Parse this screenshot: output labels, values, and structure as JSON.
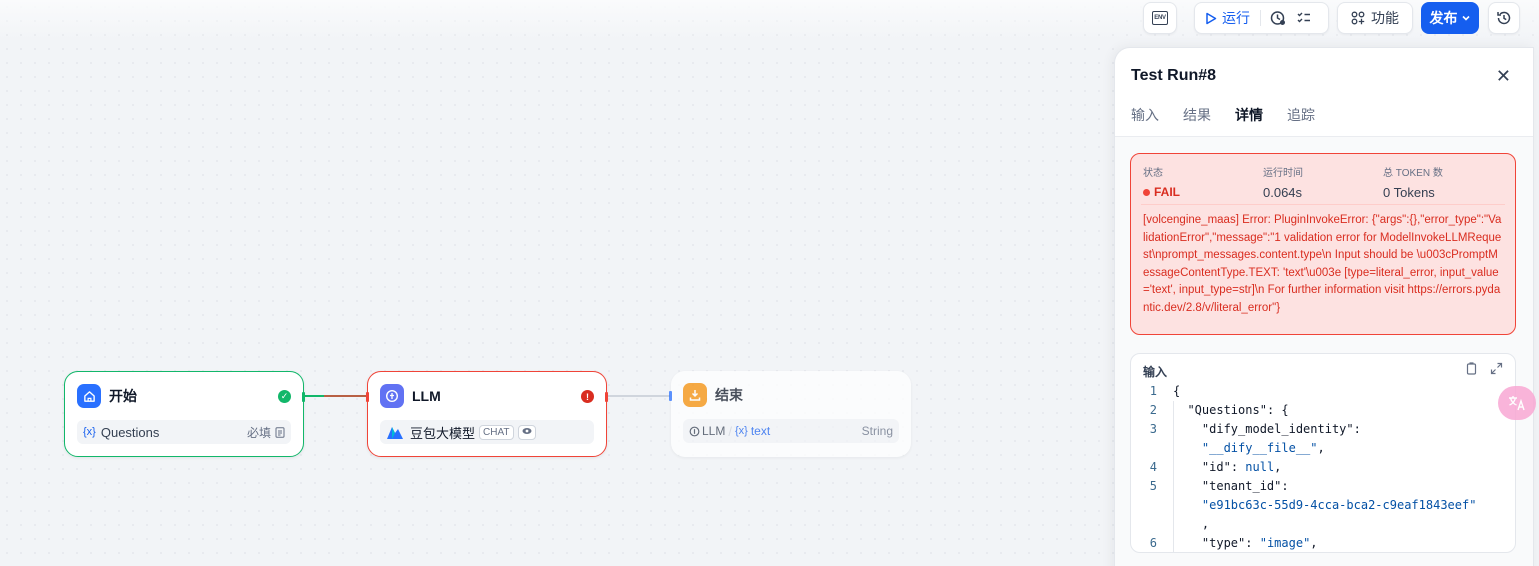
{
  "toolbar": {
    "env_label": "ENV",
    "run_label": "运行",
    "features_label": "功能",
    "publish_label": "发布"
  },
  "nodes": {
    "start": {
      "title": "开始",
      "var_symbol": "{x}",
      "var_name": "Questions",
      "required_label": "必填"
    },
    "llm": {
      "title": "LLM",
      "model_name": "豆包大模型",
      "mode_tag": "CHAT"
    },
    "end": {
      "title": "结束",
      "source": "LLM",
      "var_symbol": "{x}",
      "var_name": "text",
      "var_type": "String"
    }
  },
  "panel": {
    "title": "Test Run#8",
    "tabs": [
      "输入",
      "结果",
      "详情",
      "追踪"
    ],
    "active_tab": "详情",
    "status_label": "状态",
    "status_value": "FAIL",
    "time_label": "运行时间",
    "time_value": "0.064s",
    "tokens_label": "总 TOKEN 数",
    "tokens_value": "0 Tokens",
    "error_message": "[volcengine_maas] Error: PluginInvokeError: {\"args\":{},\"error_type\":\"ValidationError\",\"message\":\"1 validation error for ModelInvokeLLMRequest\\nprompt_messages.content.type\\n Input should be \\u003cPromptMessageContentType.TEXT: 'text'\\u003e [type=literal_error, input_value='text', input_type=str]\\n For further information visit https://errors.pydantic.dev/2.8/v/literal_error\"}",
    "input_title": "输入",
    "code_lines": [
      {
        "n": "1",
        "t": "{"
      },
      {
        "n": "2",
        "t": "  \"Questions\": {"
      },
      {
        "n": "3",
        "t": "    \"dify_model_identity\":"
      },
      {
        "n": "",
        "t": "    \"__dify__file__\","
      },
      {
        "n": "4",
        "t": "    \"id\": null,"
      },
      {
        "n": "5",
        "t": "    \"tenant_id\":"
      },
      {
        "n": "",
        "t": "    \"e91bc63c-55d9-4cca-bca2-c9eaf1843eef\""
      },
      {
        "n": "",
        "t": "    ,"
      },
      {
        "n": "6",
        "t": "    \"type\": \"image\","
      }
    ]
  },
  "colors": {
    "accent": "#155eef",
    "success": "#12b76a",
    "error": "#d92d20",
    "end_node": "#f79009"
  }
}
